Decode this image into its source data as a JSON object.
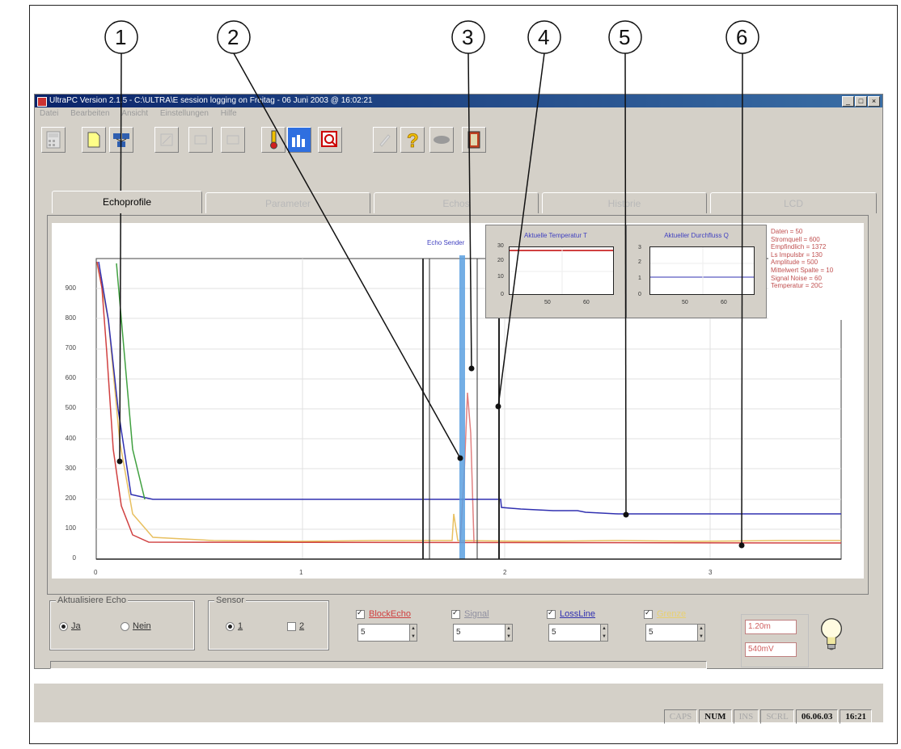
{
  "callouts": [
    "1",
    "2",
    "3",
    "4",
    "5",
    "6"
  ],
  "window": {
    "title": "UltraPC Version 2.1.5 - C:\\ULTRA\\E session logging on Freitag - 06 Juni 2003 @ 16:02:21",
    "menu": [
      "Datei",
      "Bearbeiten",
      "Ansicht",
      "Einstellungen",
      "Hilfe"
    ]
  },
  "toolbar": {
    "icons": [
      "calc-icon",
      "file-icon",
      "network-icon",
      "fill-icon",
      "send-icon",
      "receive-icon",
      "thermometer-icon",
      "chart-icon",
      "search-icon",
      "pen-icon",
      "help-icon",
      "chat-icon",
      "door-icon"
    ]
  },
  "tabs": [
    {
      "label": "Echoprofile",
      "active": true
    },
    {
      "label": "Parameter",
      "active": false
    },
    {
      "label": "Echos",
      "active": false
    },
    {
      "label": "Historie",
      "active": false
    },
    {
      "label": "LCD",
      "active": false
    }
  ],
  "chart": {
    "echo_label": "Echo Sender",
    "y_ticks": [
      "900",
      "800",
      "700",
      "600",
      "500",
      "400",
      "300",
      "200",
      "100",
      "0"
    ],
    "x_ticks": [
      "0",
      "1",
      "2",
      "3"
    ]
  },
  "mini_charts": [
    {
      "title": "Aktuelle Temperatur T",
      "y_ticks": [
        "30",
        "20",
        "10",
        "0"
      ],
      "x_ticks": [
        "50",
        "60"
      ]
    },
    {
      "title": "Aktueller Durchfluss Q",
      "y_ticks": [
        "3",
        "2",
        "1",
        "0"
      ],
      "x_ticks": [
        "50",
        "60"
      ]
    }
  ],
  "info_lines": [
    "Daten = 50",
    "Stromquell = 600",
    "Empfindlich = 1372",
    "Ls Impulsbr = 130",
    "Amplitude = 500",
    "Mittelwert Spalte = 10",
    "Signal Noise = 60",
    "Temperatur = 20C"
  ],
  "controls": {
    "actual_echo": {
      "title": "Aktualisiere Echo",
      "options": [
        "Ja",
        "Nein"
      ],
      "selected": "Ja"
    },
    "sensor": {
      "title": "Sensor",
      "options": [
        "1",
        "2"
      ],
      "selected": "1"
    },
    "series": [
      {
        "label": "BlockEcho",
        "value": "5",
        "color": "#d04040",
        "checked": true
      },
      {
        "label": "Signal",
        "value": "5",
        "color": "#9090a0",
        "checked": true
      },
      {
        "label": "LossLine",
        "value": "5",
        "color": "#3030b0",
        "checked": true
      },
      {
        "label": "Grenze",
        "value": "5",
        "color": "#e8d070",
        "checked": true
      }
    ],
    "readouts": [
      "1.20m",
      "540mV"
    ]
  },
  "status": {
    "indicators": [
      {
        "label": "CAPS",
        "active": false
      },
      {
        "label": "NUM",
        "active": true
      },
      {
        "label": "INS",
        "active": false
      },
      {
        "label": "SCRL",
        "active": false
      }
    ],
    "date": "06.06.03",
    "time": "16:21"
  },
  "colors": {
    "blocking_echo": "#d04040",
    "loss_line": "#3030b0",
    "threshold": "#e8c060",
    "echo_marker": "#5aa0e0"
  }
}
